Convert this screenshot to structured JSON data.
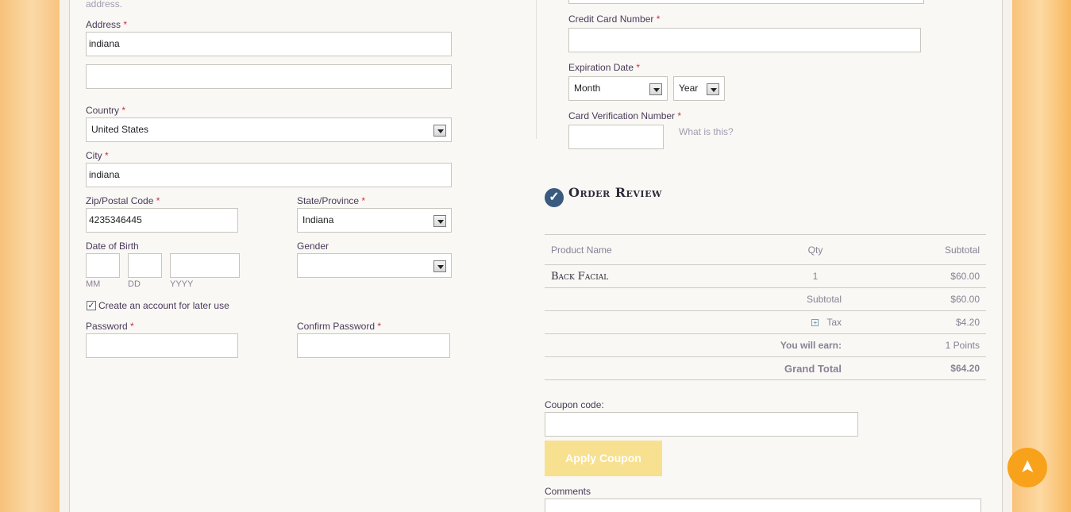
{
  "billing": {
    "top_note": "address.",
    "address_label": "Address",
    "address_line1": "indiana",
    "address_line2": "",
    "country_label": "Country",
    "country_value": "United States",
    "city_label": "City",
    "city_value": "indiana",
    "zip_label": "Zip/Postal Code",
    "zip_value": "4235346445",
    "state_label": "State/Province",
    "state_value": "Indiana",
    "dob_label": "Date of Birth",
    "dob_mm": "MM",
    "dob_dd": "DD",
    "dob_yyyy": "YYYY",
    "gender_label": "Gender",
    "gender_value": "",
    "create_account_label": "Create an account for later use",
    "create_account_checked": true,
    "password_label": "Password",
    "confirm_password_label": "Confirm Password",
    "required_mark": "*"
  },
  "payment": {
    "cc_number_label": "Credit Card Number",
    "exp_label": "Expiration Date",
    "month_value": "Month",
    "year_value": "Year",
    "cvv_label": "Card Verification Number",
    "what_is_this": "What is this?"
  },
  "review": {
    "title": "Order Review",
    "columns": [
      "Product Name",
      "Qty",
      "Subtotal"
    ],
    "product_name": "Back Facial",
    "product_qty": "1",
    "product_subtotal": "$60.00",
    "subtotal_label": "Subtotal",
    "subtotal_value": "$60.00",
    "tax_label": "Tax",
    "tax_value": "$4.20",
    "earn_label": "You will earn:",
    "earn_value": "1 Points",
    "grand_total_label": "Grand Total",
    "grand_total_value": "$64.20"
  },
  "coupon": {
    "label": "Coupon code:",
    "value": "",
    "apply_button": "Apply Coupon"
  },
  "comments": {
    "label": "Comments"
  },
  "scroll_top_icon": "arrow-up-icon",
  "colors": {
    "accent_orange": "#f7a21a",
    "apply_button_bg": "#f7e090",
    "required_red": "#c8324a"
  }
}
